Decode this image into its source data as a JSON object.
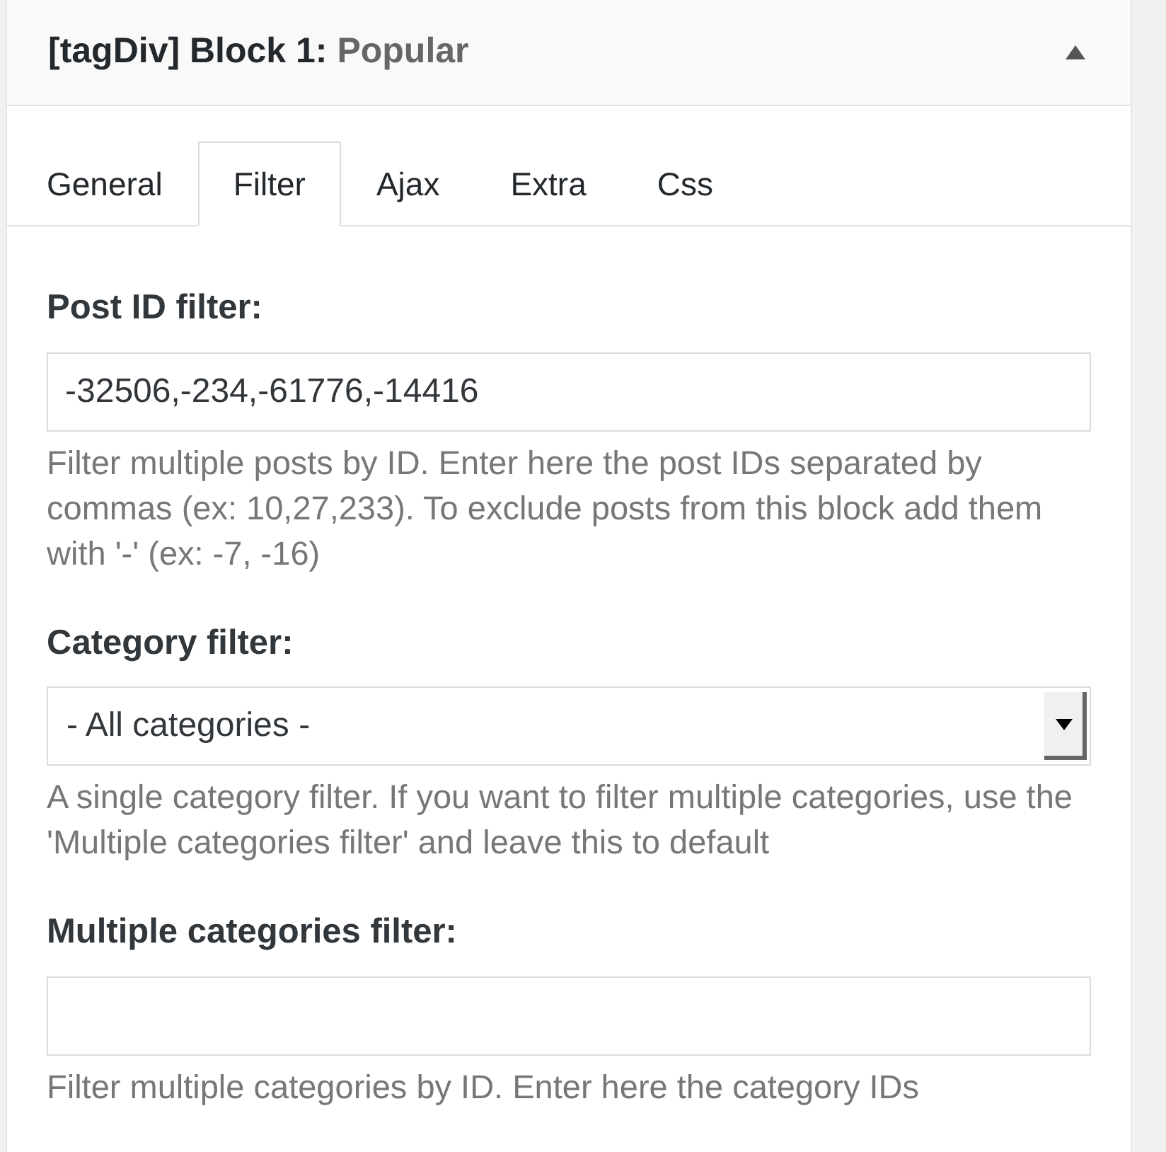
{
  "panel": {
    "title": "[tagDiv] Block 1:",
    "subtitle": "Popular",
    "expanded": true
  },
  "tabs": [
    {
      "label": "General",
      "selected": false
    },
    {
      "label": "Filter",
      "selected": true
    },
    {
      "label": "Ajax",
      "selected": false
    },
    {
      "label": "Extra",
      "selected": false
    },
    {
      "label": "Css",
      "selected": false
    }
  ],
  "fields": [
    {
      "kind": "text",
      "label": "Post ID filter:",
      "value": "-32506,-234,-61776,-14416",
      "help": "Filter multiple posts by ID. Enter here the post IDs separated by commas (ex: 10,27,233). To exclude posts from this block add them with '-' (ex: -7, -16)"
    },
    {
      "kind": "select",
      "label": "Category filter:",
      "value": "- All categories -",
      "help": "A single category filter. If you want to filter multiple categories, use the 'Multiple categories filter' and leave this to default"
    },
    {
      "kind": "text",
      "label": "Multiple categories filter:",
      "help": "Filter multiple categories by ID. Enter here the category IDs"
    }
  ]
}
